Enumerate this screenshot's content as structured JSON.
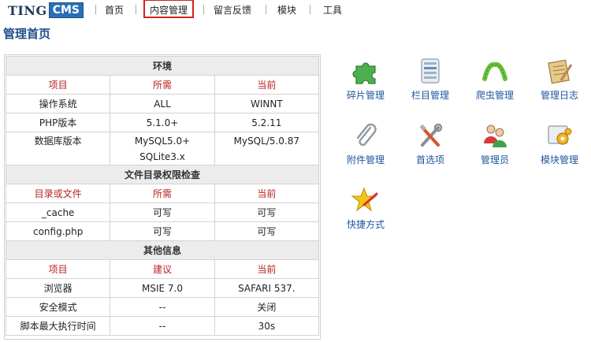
{
  "logo": {
    "ting": "TING",
    "cms": "CMS"
  },
  "nav": [
    {
      "label": "首页"
    },
    {
      "label": "内容管理"
    },
    {
      "label": "留言反馈"
    },
    {
      "label": "模块"
    },
    {
      "label": "工具"
    }
  ],
  "page_title": "管理首页",
  "env": {
    "section": "环境",
    "headers": [
      "项目",
      "所需",
      "当前"
    ],
    "rows": [
      [
        "操作系统",
        "ALL",
        "WINNT"
      ],
      [
        "PHP版本",
        "5.1.0+",
        "5.2.11"
      ],
      [
        "数据库版本",
        "MySQL5.0+\nSQLite3.x",
        "MySQL/5.0.87"
      ]
    ]
  },
  "perm": {
    "section": "文件目录权限检查",
    "headers": [
      "目录或文件",
      "所需",
      "当前"
    ],
    "rows": [
      [
        "_cache",
        "可写",
        "可写"
      ],
      [
        "config.php",
        "可写",
        "可写"
      ]
    ]
  },
  "other": {
    "section": "其他信息",
    "headers": [
      "项目",
      "建议",
      "当前"
    ],
    "rows": [
      [
        "浏览器",
        "MSIE 7.0",
        "SAFARI 537."
      ],
      [
        "安全模式",
        "--",
        "关闭"
      ],
      [
        "脚本最大执行时间",
        "--",
        "30s"
      ]
    ]
  },
  "shortcuts": [
    {
      "label": "碎片管理",
      "icon": "puzzle-icon"
    },
    {
      "label": "栏目管理",
      "icon": "column-list-icon"
    },
    {
      "label": "爬虫管理",
      "icon": "crawler-worm-icon"
    },
    {
      "label": "管理日志",
      "icon": "log-notepad-icon"
    },
    {
      "label": "附件管理",
      "icon": "paperclip-icon"
    },
    {
      "label": "首选项",
      "icon": "tools-icon"
    },
    {
      "label": "管理员",
      "icon": "users-icon"
    },
    {
      "label": "模块管理",
      "icon": "module-gears-icon"
    },
    {
      "label": "快捷方式",
      "icon": "star-wand-icon"
    }
  ],
  "colors": {
    "accent": "#1e56a0",
    "title": "#1e4e8c",
    "header_red": "#b22222",
    "active_border": "#d42020"
  }
}
